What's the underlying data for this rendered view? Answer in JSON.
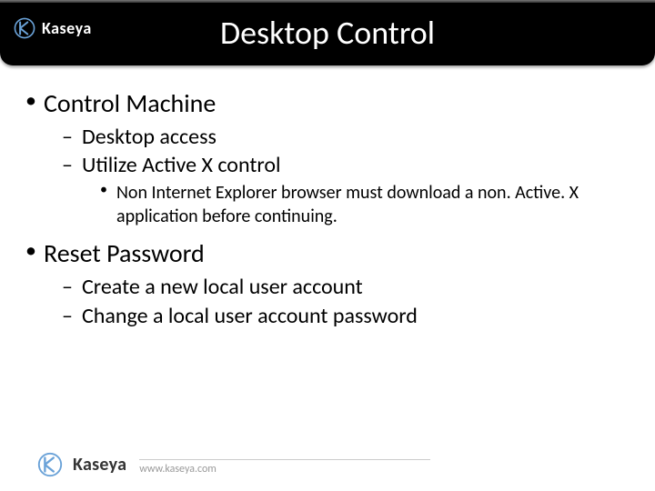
{
  "header": {
    "brand": "Kaseya",
    "title": "Desktop Control"
  },
  "bullets": [
    {
      "text": "Control Machine",
      "children": [
        {
          "text": "Desktop access"
        },
        {
          "text": "Utilize Active X control",
          "children": [
            {
              "text": "Non Internet Explorer browser must download a non. Active. X application before continuing."
            }
          ]
        }
      ]
    },
    {
      "text": "Reset Password",
      "children": [
        {
          "text": "Create a new local user account"
        },
        {
          "text": "Change a local user account password"
        }
      ]
    }
  ],
  "footer": {
    "brand": "Kaseya",
    "url": "www.kaseya.com"
  }
}
